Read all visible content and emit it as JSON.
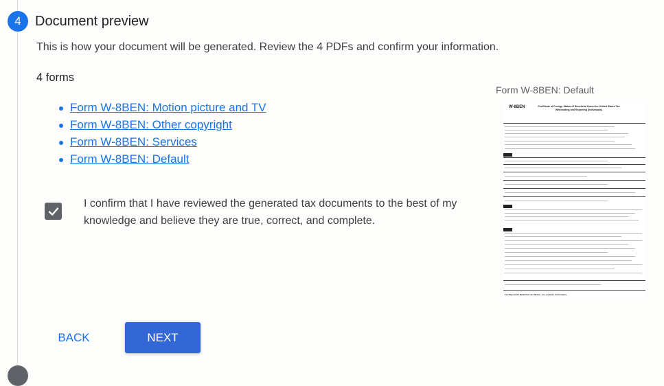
{
  "step": {
    "number": "4",
    "title": "Document preview",
    "intro": "This is how your document will be generated. Review the 4 PDFs and confirm your information."
  },
  "forms": {
    "heading": "4 forms",
    "items": [
      {
        "label": "Form W-8BEN: Motion picture and TV"
      },
      {
        "label": "Form W-8BEN: Other copyright"
      },
      {
        "label": "Form W-8BEN: Services"
      },
      {
        "label": "Form W-8BEN: Default"
      }
    ]
  },
  "confirmation": {
    "checked": true,
    "text": "I confirm that I have reviewed the generated tax documents to the best of my knowledge and believe they are true, correct, and complete."
  },
  "preview": {
    "label": "Form W-8BEN: Default",
    "doc_form": "W-8BEN",
    "doc_title": "Certificate of Foreign Status of Beneficial Owner for United States Tax Withholding and Reporting (Individuals)",
    "doc_footer": "For Paperwork Reduction Act Notice, see separate instructions."
  },
  "buttons": {
    "back": "BACK",
    "next": "NEXT"
  },
  "colors": {
    "accent": "#1a73e8",
    "primary_button": "#3367d6",
    "checkbox": "#5f6368"
  }
}
